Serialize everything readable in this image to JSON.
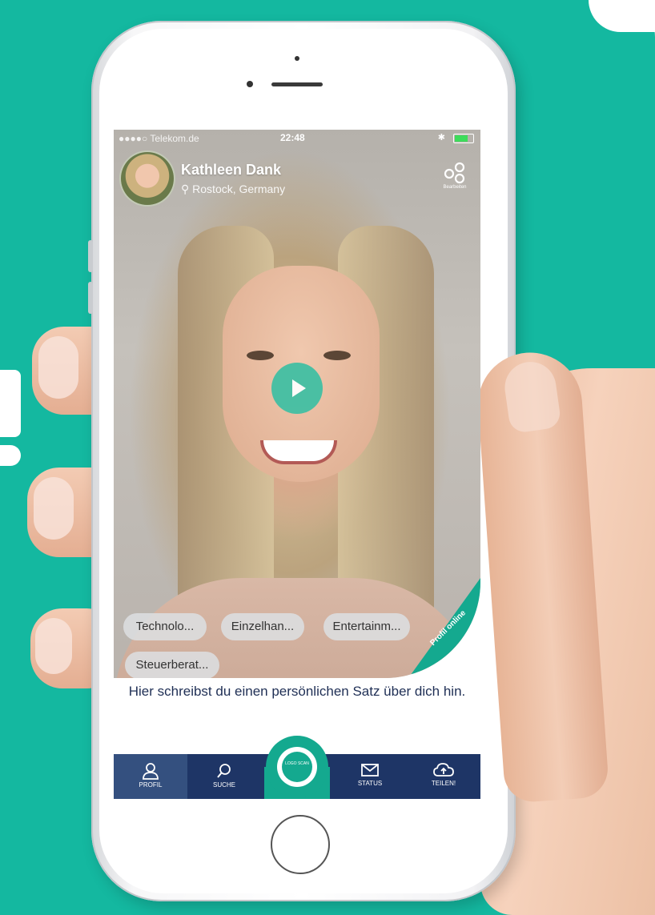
{
  "status_bar": {
    "carrier": "●●●●○ Telekom.de",
    "time": "22:48"
  },
  "profile": {
    "name": "Kathleen Dank",
    "location": "Rostock, Germany",
    "edit_label": "Bearbeiten",
    "online_badge": "Profil online"
  },
  "tags": [
    "Technolo...",
    "Einzelhan...",
    "Entertainm...",
    "Steuerberat..."
  ],
  "about_text": "Hier schreibst du einen persönlichen Satz über dich hin.",
  "tabbar": {
    "profil": "PROFIL",
    "suche": "SUCHE",
    "scan": "LOGO SCAN",
    "status": "STATUS",
    "teilen": "TEILEN!"
  },
  "colors": {
    "brand_teal": "#14b8a0",
    "nav_blue": "#1e3566"
  },
  "icons": [
    "location-pin-icon",
    "gear-icon",
    "play-icon",
    "user-icon",
    "search-icon",
    "mail-icon",
    "cloud-upload-icon"
  ]
}
